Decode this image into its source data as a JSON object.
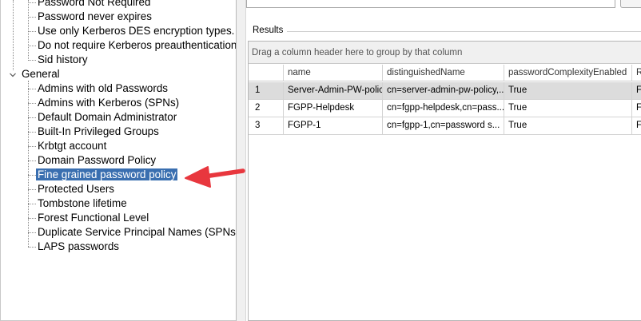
{
  "tree": {
    "top_items": [
      "Password Not Required",
      "Password never expires",
      "Use only Kerberos DES encryption types.",
      "Do not require Kerberos preauthentication",
      "Sid history"
    ],
    "group_label": "General",
    "general_items": [
      "Admins with old Passwords",
      "Admins with Kerberos (SPNs)",
      "Default Domain Administrator",
      "Built-In Privileged Groups",
      "Krbtgt account",
      "Domain Password Policy",
      "Fine grained password policy",
      "Protected Users",
      "Tombstone lifetime",
      "Forest Functional Level",
      "Duplicate Service Principal Names (SPNs",
      "LAPS passwords"
    ],
    "selected_item": "Fine grained password policy"
  },
  "results": {
    "label": "Results",
    "group_panel_text": "Drag a column header here to group by that column",
    "columns": [
      "name",
      "distinguishedName",
      "passwordComplexityEnabled",
      "R"
    ],
    "rows": [
      [
        "1",
        "Server-Admin-PW-policy",
        "cn=server-admin-pw-policy,...",
        "True",
        "Fa"
      ],
      [
        "2",
        "FGPP-Helpdesk",
        "cn=fgpp-helpdesk,cn=pass...",
        "True",
        "Fa"
      ],
      [
        "3",
        "FGPP-1",
        "cn=fgpp-1,cn=password s...",
        "True",
        "Fa"
      ]
    ]
  },
  "colors": {
    "selection": "#3a6fb0",
    "arrow": "#e8373e"
  },
  "icons": {
    "expander": "collapse-chevron-icon",
    "annotation": "red-arrow-icon"
  }
}
